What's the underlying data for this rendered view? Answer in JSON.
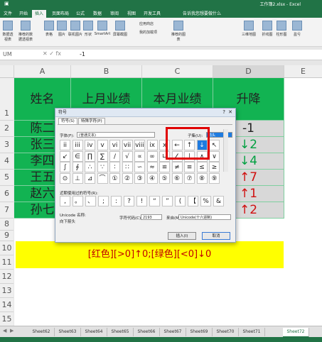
{
  "app": {
    "title": "工作簿2.xlsx - Excel"
  },
  "ribbon_tabs": [
    "文件",
    "开始",
    "插入",
    "页面布局",
    "公式",
    "数据",
    "审阅",
    "视图",
    "开发工具"
  ],
  "ribbon_tab_active": "插入",
  "ribbon_search": "告诉我您想要做什么",
  "ribbon_buttons": [
    "数据透视表",
    "推荐的数据透视表",
    "表格",
    "图片",
    "联机图片",
    "形状",
    "SmartArt",
    "屏幕截图",
    "应用商店",
    "我的加载项",
    "推荐的图表",
    "三维地图",
    "折线图",
    "柱形图",
    "盈亏"
  ],
  "formula_bar": {
    "namebox": "UM",
    "formula": "-1"
  },
  "columns": [
    "A",
    "B",
    "C",
    "D",
    "E"
  ],
  "rows": [
    "1",
    "2",
    "3",
    "4",
    "5",
    "6",
    "7",
    "8",
    "9",
    "10",
    "11",
    "12",
    "13",
    "14",
    "15"
  ],
  "table": {
    "headers": [
      "姓名",
      "上月业绩",
      "本月业绩",
      "升降"
    ],
    "names": [
      "陈二",
      "张三",
      "李四",
      "王五",
      "赵六",
      "孙七"
    ],
    "changes": [
      "-1",
      "↓2",
      "↓4",
      "↑7",
      "↑1",
      "↑2"
    ],
    "change_colors": [
      "#222222",
      "#00a040",
      "#00a040",
      "#d01010",
      "#d01010",
      "#d01010"
    ]
  },
  "banner": "[红色][>0]↑0;[绿色][<0]↓0",
  "dialog": {
    "title": "符号",
    "tabs": [
      "符号(S)",
      "特殊字符(P)"
    ],
    "font_label": "字体(F):",
    "font_value": "(普通文本)",
    "subset_label": "子集(U):",
    "subset_value": "箭头",
    "grid_row1": [
      "ii",
      "iii",
      "iv",
      "v",
      "vi",
      "vii",
      "viii",
      "ix",
      "x",
      "←",
      "↑",
      "↓",
      "↖"
    ],
    "grid_row2": [
      "↙",
      "∈",
      "∏",
      "∑",
      "/",
      "√",
      "∝",
      "∞",
      "∟",
      "∠",
      "∣",
      "∧",
      "∨"
    ],
    "grid_row3": [
      "∫",
      "∮",
      "∴",
      "∵",
      "∶",
      "∷",
      "∽",
      "≈",
      "≌",
      "≠",
      "≡",
      "≤",
      "≥"
    ],
    "grid_row4": [
      "⊙",
      "⊥",
      "⊿",
      "⌒",
      "①",
      "②",
      "③",
      "④",
      "⑤",
      "⑥",
      "⑦",
      "⑧",
      "⑨"
    ],
    "recent_label": "近期使用过的符号(R):",
    "recent": [
      ",",
      "。",
      "、",
      ";",
      ":",
      "?",
      "!",
      "“",
      "”",
      "(",
      "【",
      "%",
      "&"
    ],
    "unicode_label": "Unicode 名称:",
    "unicode_name": "向下箭头",
    "charcode_label": "字符代码(C):",
    "charcode_value": "2193",
    "from_label": "来自(M):",
    "from_value": "Unicode(十六进制)",
    "insert_btn": "插入(I)",
    "cancel_btn": "取消"
  },
  "sheet_tabs": [
    "Sheet62",
    "Sheet63",
    "Sheet64",
    "Sheet65",
    "Sheet66",
    "Sheet67",
    "Sheet69",
    "Sheet70",
    "Sheet71",
    "Sheet72"
  ],
  "sheet_active": "Sheet72"
}
